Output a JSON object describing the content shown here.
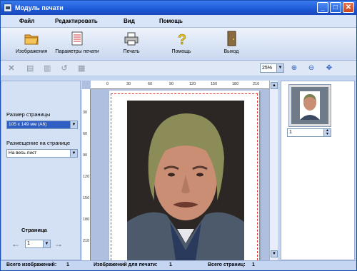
{
  "window": {
    "title": "Модуль печати",
    "controls": [
      "_",
      "□",
      "✕"
    ]
  },
  "menu": {
    "items": [
      "Файл",
      "Редактировать",
      "Вид",
      "Помощь"
    ]
  },
  "toolbar": {
    "items": [
      {
        "label": "Изображения",
        "icon": "folder-icon"
      },
      {
        "label": "Параметры печати",
        "icon": "document-settings-icon"
      },
      {
        "label": "Печать",
        "icon": "printer-icon"
      },
      {
        "label": "Помощь",
        "icon": "help-icon"
      },
      {
        "label": "Выход",
        "icon": "exit-door-icon"
      }
    ]
  },
  "secondary_toolbar": {
    "zoom": "25%",
    "zoom_dropdown": "▼"
  },
  "left_panel": {
    "page_size_label": "Размер страницы",
    "page_size_value": "105 x 149 мм (A6)",
    "placement_label": "Размещение на странице",
    "placement_value": "На весь лист",
    "page_label": "Страница",
    "page_value": "1",
    "prev_arrow": "←",
    "next_arrow": "→"
  },
  "ruler": {
    "h_ticks": [
      "0",
      "30",
      "60",
      "90",
      "120",
      "150",
      "180",
      "210"
    ],
    "v_ticks": [
      "30",
      "60",
      "90",
      "120",
      "150",
      "180",
      "210"
    ]
  },
  "right_panel": {
    "copies": "1"
  },
  "status": {
    "total_images_label": "Всего изображений:",
    "total_images_value": "1",
    "images_to_print_label": "Изображений для печати:",
    "images_to_print_value": "1",
    "total_pages_label": "Всего страниц:",
    "total_pages_value": "1"
  },
  "colors": {
    "titlebar": "#1d58d6",
    "panel_bg": "#c5d6f2",
    "dashed_margin": "#dd3333"
  }
}
